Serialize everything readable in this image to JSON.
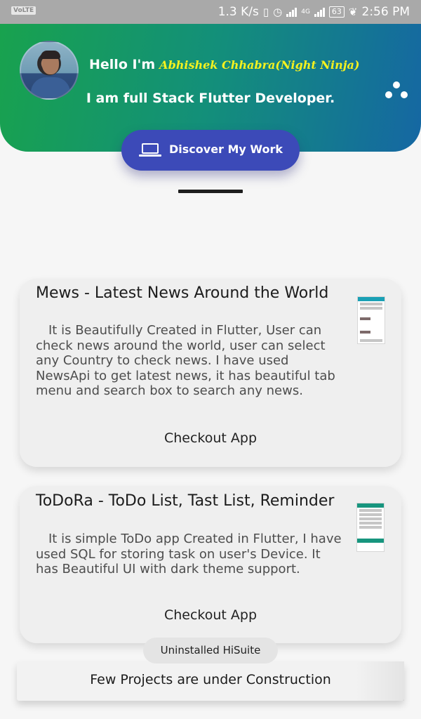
{
  "status_bar": {
    "volte": "VoLTE",
    "net_speed": "1.3 K/s",
    "network": "4G",
    "battery": "63",
    "time": "2:56 PM"
  },
  "header": {
    "hello": "Hello I'm",
    "name": "Abhishek Chhabra(Night Ninja)",
    "tagline": "I am full Stack Flutter Developer.",
    "colors": {
      "gradient_start": "#18a24e",
      "gradient_end": "#1567a3",
      "name_color": "#f5f21f"
    }
  },
  "discover_button": {
    "label": "Discover My Work",
    "color": "#3c4ab8",
    "icon": "laptop-icon"
  },
  "projects": [
    {
      "title": "Mews - Latest News Around the World",
      "description": "It is Beautifully Created in Flutter, User can check news around the world, user can select any Country to check news. I have used NewsApi to get latest news, it has beautiful tab menu and search box to search any news.",
      "cta": "Checkout App"
    },
    {
      "title": "ToDoRa - ToDo List, Tast List, Reminder",
      "description": "It is simple ToDo app Created in Flutter, I have used SQL for storing task on user's Device. It has Beautiful UI with dark theme support.",
      "cta": "Checkout App"
    }
  ],
  "toast": "Uninstalled HiSuite",
  "footer": "Few Projects are under Construction"
}
